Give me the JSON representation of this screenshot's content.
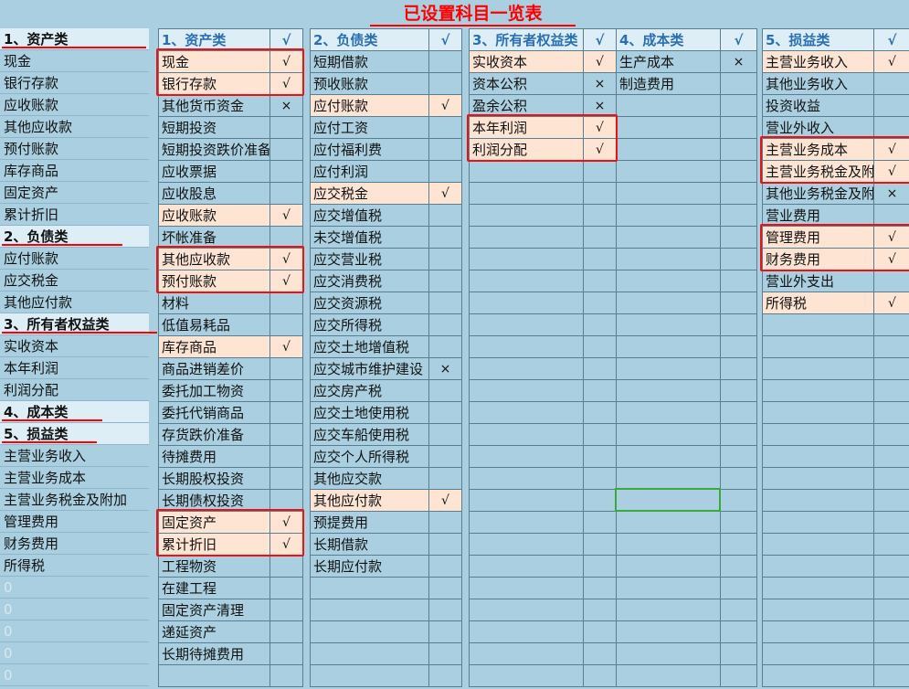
{
  "title": "已设置科目一览表",
  "left_list": [
    {
      "text": "1、资产类",
      "type": "hdr"
    },
    {
      "text": "现金",
      "type": "item"
    },
    {
      "text": "银行存款",
      "type": "item"
    },
    {
      "text": "应收账款",
      "type": "item"
    },
    {
      "text": "其他应收款",
      "type": "item"
    },
    {
      "text": "预付账款",
      "type": "item"
    },
    {
      "text": "库存商品",
      "type": "item"
    },
    {
      "text": "固定资产",
      "type": "item"
    },
    {
      "text": "累计折旧",
      "type": "item"
    },
    {
      "text": "2、负债类",
      "type": "hdr"
    },
    {
      "text": "应付账款",
      "type": "item"
    },
    {
      "text": "应交税金",
      "type": "item"
    },
    {
      "text": "其他应付款",
      "type": "item"
    },
    {
      "text": "3、所有者权益类",
      "type": "hdr"
    },
    {
      "text": "实收资本",
      "type": "item"
    },
    {
      "text": "本年利润",
      "type": "item"
    },
    {
      "text": "利润分配",
      "type": "item"
    },
    {
      "text": "4、成本类",
      "type": "hdr"
    },
    {
      "text": "5、损益类",
      "type": "hdr"
    },
    {
      "text": "主营业务收入",
      "type": "item"
    },
    {
      "text": "主营业务成本",
      "type": "item"
    },
    {
      "text": "主营业务税金及附加",
      "type": "item"
    },
    {
      "text": "管理费用",
      "type": "item"
    },
    {
      "text": "财务费用",
      "type": "item"
    },
    {
      "text": "所得税",
      "type": "item"
    },
    {
      "text": "0",
      "type": "zero"
    },
    {
      "text": "0",
      "type": "zero"
    },
    {
      "text": "0",
      "type": "zero"
    },
    {
      "text": "0",
      "type": "zero"
    },
    {
      "text": "0",
      "type": "zero"
    }
  ],
  "columns": [
    {
      "key": "assets",
      "header": "1、资产类",
      "header_mark": "√",
      "rows": [
        {
          "name": "现金",
          "mark": "√",
          "sel": true
        },
        {
          "name": "银行存款",
          "mark": "√",
          "sel": true
        },
        {
          "name": "其他货币资金",
          "mark": "×",
          "sel": false
        },
        {
          "name": "短期投资",
          "mark": "",
          "sel": false
        },
        {
          "name": "短期投资跌价准备",
          "mark": "",
          "sel": false
        },
        {
          "name": "应收票据",
          "mark": "",
          "sel": false
        },
        {
          "name": "应收股息",
          "mark": "",
          "sel": false
        },
        {
          "name": "应收账款",
          "mark": "√",
          "sel": true
        },
        {
          "name": "坏帐准备",
          "mark": "",
          "sel": false
        },
        {
          "name": "其他应收款",
          "mark": "√",
          "sel": true
        },
        {
          "name": "预付账款",
          "mark": "√",
          "sel": true
        },
        {
          "name": "材料",
          "mark": "",
          "sel": false
        },
        {
          "name": "低值易耗品",
          "mark": "",
          "sel": false
        },
        {
          "name": "库存商品",
          "mark": "√",
          "sel": true
        },
        {
          "name": "商品进销差价",
          "mark": "",
          "sel": false
        },
        {
          "name": "委托加工物资",
          "mark": "",
          "sel": false
        },
        {
          "name": "委托代销商品",
          "mark": "",
          "sel": false
        },
        {
          "name": "存货跌价准备",
          "mark": "",
          "sel": false
        },
        {
          "name": "待摊费用",
          "mark": "",
          "sel": false
        },
        {
          "name": "长期股权投资",
          "mark": "",
          "sel": false
        },
        {
          "name": "长期债权投资",
          "mark": "",
          "sel": false
        },
        {
          "name": "固定资产",
          "mark": "√",
          "sel": true
        },
        {
          "name": "累计折旧",
          "mark": "√",
          "sel": true
        },
        {
          "name": "工程物资",
          "mark": "",
          "sel": false
        },
        {
          "name": "在建工程",
          "mark": "",
          "sel": false
        },
        {
          "name": "固定资产清理",
          "mark": "",
          "sel": false
        },
        {
          "name": "递延资产",
          "mark": "",
          "sel": false
        },
        {
          "name": "长期待摊费用",
          "mark": "",
          "sel": false
        },
        {
          "name": "",
          "mark": "",
          "sel": false
        }
      ]
    },
    {
      "key": "liabilities",
      "header": "2、负债类",
      "header_mark": "√",
      "rows": [
        {
          "name": "短期借款",
          "mark": "",
          "sel": false
        },
        {
          "name": "预收账款",
          "mark": "",
          "sel": false
        },
        {
          "name": "应付账款",
          "mark": "√",
          "sel": true
        },
        {
          "name": "应付工资",
          "mark": "",
          "sel": false
        },
        {
          "name": "应付福利费",
          "mark": "",
          "sel": false
        },
        {
          "name": "应付利润",
          "mark": "",
          "sel": false
        },
        {
          "name": "应交税金",
          "mark": "√",
          "sel": true
        },
        {
          "name": "应交增值税",
          "mark": "",
          "sel": false
        },
        {
          "name": "未交增值税",
          "mark": "",
          "sel": false
        },
        {
          "name": "应交营业税",
          "mark": "",
          "sel": false
        },
        {
          "name": "应交消费税",
          "mark": "",
          "sel": false
        },
        {
          "name": "应交资源税",
          "mark": "",
          "sel": false
        },
        {
          "name": "应交所得税",
          "mark": "",
          "sel": false
        },
        {
          "name": "应交土地增值税",
          "mark": "",
          "sel": false
        },
        {
          "name": "应交城市维护建设",
          "mark": "×",
          "sel": false
        },
        {
          "name": "应交房产税",
          "mark": "",
          "sel": false
        },
        {
          "name": "应交土地使用税",
          "mark": "",
          "sel": false
        },
        {
          "name": "应交车船使用税",
          "mark": "",
          "sel": false
        },
        {
          "name": "应交个人所得税",
          "mark": "",
          "sel": false
        },
        {
          "name": "其他应交款",
          "mark": "",
          "sel": false
        },
        {
          "name": "其他应付款",
          "mark": "√",
          "sel": true
        },
        {
          "name": "预提费用",
          "mark": "",
          "sel": false
        },
        {
          "name": "长期借款",
          "mark": "",
          "sel": false
        },
        {
          "name": "长期应付款",
          "mark": "",
          "sel": false
        },
        {
          "name": "",
          "mark": "",
          "sel": false
        },
        {
          "name": "",
          "mark": "",
          "sel": false
        },
        {
          "name": "",
          "mark": "",
          "sel": false
        },
        {
          "name": "",
          "mark": "",
          "sel": false
        },
        {
          "name": "",
          "mark": "",
          "sel": false
        }
      ]
    },
    {
      "key": "equity",
      "header": "3、所有者权益类",
      "header_mark": "√",
      "rows": [
        {
          "name": "实收资本",
          "mark": "√",
          "sel": true
        },
        {
          "name": "资本公积",
          "mark": "×",
          "sel": false
        },
        {
          "name": "盈余公积",
          "mark": "×",
          "sel": false
        },
        {
          "name": "本年利润",
          "mark": "√",
          "sel": true
        },
        {
          "name": "利润分配",
          "mark": "√",
          "sel": true
        },
        {
          "name": "",
          "mark": "",
          "sel": false
        },
        {
          "name": "",
          "mark": "",
          "sel": false
        },
        {
          "name": "",
          "mark": "",
          "sel": false
        },
        {
          "name": "",
          "mark": "",
          "sel": false
        },
        {
          "name": "",
          "mark": "",
          "sel": false
        },
        {
          "name": "",
          "mark": "",
          "sel": false
        },
        {
          "name": "",
          "mark": "",
          "sel": false
        },
        {
          "name": "",
          "mark": "",
          "sel": false
        },
        {
          "name": "",
          "mark": "",
          "sel": false
        },
        {
          "name": "",
          "mark": "",
          "sel": false
        },
        {
          "name": "",
          "mark": "",
          "sel": false
        },
        {
          "name": "",
          "mark": "",
          "sel": false
        },
        {
          "name": "",
          "mark": "",
          "sel": false
        },
        {
          "name": "",
          "mark": "",
          "sel": false
        },
        {
          "name": "",
          "mark": "",
          "sel": false
        },
        {
          "name": "",
          "mark": "",
          "sel": false
        },
        {
          "name": "",
          "mark": "",
          "sel": false
        },
        {
          "name": "",
          "mark": "",
          "sel": false
        },
        {
          "name": "",
          "mark": "",
          "sel": false
        },
        {
          "name": "",
          "mark": "",
          "sel": false
        },
        {
          "name": "",
          "mark": "",
          "sel": false
        },
        {
          "name": "",
          "mark": "",
          "sel": false
        },
        {
          "name": "",
          "mark": "",
          "sel": false
        },
        {
          "name": "",
          "mark": "",
          "sel": false
        }
      ]
    },
    {
      "key": "cost",
      "header": "4、成本类",
      "header_mark": "√",
      "rows": [
        {
          "name": "生产成本",
          "mark": "×",
          "sel": false
        },
        {
          "name": "制造费用",
          "mark": "",
          "sel": false
        },
        {
          "name": "",
          "mark": "",
          "sel": false
        },
        {
          "name": "",
          "mark": "",
          "sel": false
        },
        {
          "name": "",
          "mark": "",
          "sel": false
        },
        {
          "name": "",
          "mark": "",
          "sel": false
        },
        {
          "name": "",
          "mark": "",
          "sel": false
        },
        {
          "name": "",
          "mark": "",
          "sel": false
        },
        {
          "name": "",
          "mark": "",
          "sel": false
        },
        {
          "name": "",
          "mark": "",
          "sel": false
        },
        {
          "name": "",
          "mark": "",
          "sel": false
        },
        {
          "name": "",
          "mark": "",
          "sel": false
        },
        {
          "name": "",
          "mark": "",
          "sel": false
        },
        {
          "name": "",
          "mark": "",
          "sel": false
        },
        {
          "name": "",
          "mark": "",
          "sel": false
        },
        {
          "name": "",
          "mark": "",
          "sel": false
        },
        {
          "name": "",
          "mark": "",
          "sel": false
        },
        {
          "name": "",
          "mark": "",
          "sel": false
        },
        {
          "name": "",
          "mark": "",
          "sel": false
        },
        {
          "name": "",
          "mark": "",
          "sel": false
        },
        {
          "name": "",
          "mark": "",
          "sel": false
        },
        {
          "name": "",
          "mark": "",
          "sel": false
        },
        {
          "name": "",
          "mark": "",
          "sel": false
        },
        {
          "name": "",
          "mark": "",
          "sel": false
        },
        {
          "name": "",
          "mark": "",
          "sel": false
        },
        {
          "name": "",
          "mark": "",
          "sel": false
        },
        {
          "name": "",
          "mark": "",
          "sel": false
        },
        {
          "name": "",
          "mark": "",
          "sel": false
        },
        {
          "name": "",
          "mark": "",
          "sel": false
        }
      ]
    },
    {
      "key": "pnl",
      "header": "5、损益类",
      "header_mark": "√",
      "rows": [
        {
          "name": "主营业务收入",
          "mark": "√",
          "sel": true
        },
        {
          "name": "其他业务收入",
          "mark": "",
          "sel": false
        },
        {
          "name": "投资收益",
          "mark": "",
          "sel": false
        },
        {
          "name": "营业外收入",
          "mark": "",
          "sel": false
        },
        {
          "name": "主营业务成本",
          "mark": "√",
          "sel": true
        },
        {
          "name": "主营业务税金及附",
          "mark": "√",
          "sel": true
        },
        {
          "name": "其他业务税金及附",
          "mark": "×",
          "sel": false
        },
        {
          "name": "营业费用",
          "mark": "",
          "sel": false
        },
        {
          "name": "管理费用",
          "mark": "√",
          "sel": true
        },
        {
          "name": "财务费用",
          "mark": "√",
          "sel": true
        },
        {
          "name": "营业外支出",
          "mark": "",
          "sel": false
        },
        {
          "name": "所得税",
          "mark": "√",
          "sel": true
        },
        {
          "name": "",
          "mark": "",
          "sel": false
        },
        {
          "name": "",
          "mark": "",
          "sel": false
        },
        {
          "name": "",
          "mark": "",
          "sel": false
        },
        {
          "name": "",
          "mark": "",
          "sel": false
        },
        {
          "name": "",
          "mark": "",
          "sel": false
        },
        {
          "name": "",
          "mark": "",
          "sel": false
        },
        {
          "name": "",
          "mark": "",
          "sel": false
        },
        {
          "name": "",
          "mark": "",
          "sel": false
        },
        {
          "name": "",
          "mark": "",
          "sel": false
        },
        {
          "name": "",
          "mark": "",
          "sel": false
        },
        {
          "name": "",
          "mark": "",
          "sel": false
        },
        {
          "name": "",
          "mark": "",
          "sel": false
        },
        {
          "name": "",
          "mark": "",
          "sel": false
        },
        {
          "name": "",
          "mark": "",
          "sel": false
        },
        {
          "name": "",
          "mark": "",
          "sel": false
        },
        {
          "name": "",
          "mark": "",
          "sel": false
        },
        {
          "name": "",
          "mark": "",
          "sel": false
        }
      ]
    }
  ],
  "colors": {
    "highlight_bg": "#fde4d3",
    "red": "#ff0000",
    "background": "#a9cfe0",
    "header_blue": "#2a6fb5",
    "active_cell": "#3aa83a"
  }
}
